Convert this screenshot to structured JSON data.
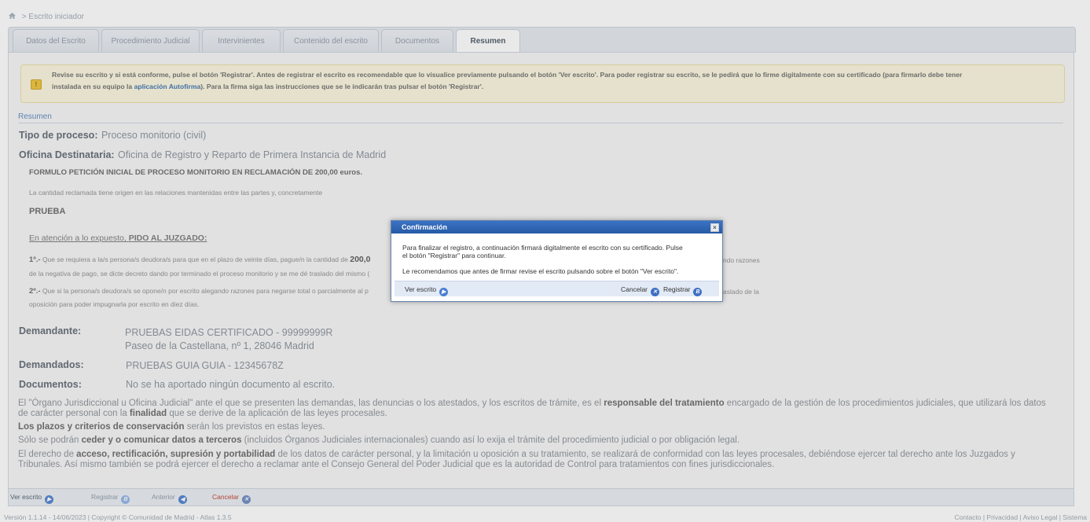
{
  "breadcrumb": {
    "separator": ">",
    "current": "Escrito iniciador"
  },
  "tabs": [
    {
      "label": "Datos del Escrito"
    },
    {
      "label": "Procedimiento Judicial"
    },
    {
      "label": "Intervinientes"
    },
    {
      "label": "Contenido del escrito"
    },
    {
      "label": "Documentos"
    },
    {
      "label": "Resumen"
    }
  ],
  "active_tab": "Resumen",
  "warning": {
    "text1": "Revise su escrito y si está conforme, pulse el botón 'Registrar'. Antes de registrar el escrito es recomendable que lo visualice previamente pulsando el botón 'Ver escrito'. Para poder registrar su escrito, se le pedirá que lo firme digitalmente con su certificado (para firmarlo debe tener",
    "text2": "instalada en su equipo la",
    "link": "aplicación Autofirma",
    "text3": "). Para la firma siga las instrucciones que se le indicarán tras pulsar el botón 'Registrar'."
  },
  "summary": {
    "section_title": "Resumen",
    "tipo_label": "Tipo de proceso:",
    "tipo_value": "Proceso monitorio (civil)",
    "oficina_label": "Oficina Destinataria:",
    "oficina_value": "Oficina de Registro y Reparto de Primera Instancia de Madrid",
    "formulo": "FORMULO PETICIÓN INICIAL DE PROCESO MONITORIO EN RECLAMACIÓN DE 200,00 euros.",
    "origen": "La cantidad reclamada tiene origen en las relaciones mantenidas entre las partes y, concretamente",
    "prueba": "PRUEBA",
    "atencion": "En atención a lo expuesto,",
    "pido": "PIDO AL JUZGADO:",
    "p1_num": "1º.-",
    "p1_a": "Que se requiera a la/s persona/s deudora/s para que en el plazo de veinte días, pague/n la cantidad de",
    "p1_amount": "200,0",
    "p1_right": "ndo razones",
    "p1_b": "de la negativa de pago, se dicte decreto dando por terminado el proceso monitorio y se me dé traslado del mismo (",
    "p2_num": "2º.-",
    "p2_a": "Que si la persona/s deudora/s se opone/n por escrito alegando razones para negarse total o parcialmente al p",
    "p2_right": "aslado de la",
    "p2_b": "oposición para poder impugnarla por escrito en diez días.",
    "demandante_label": "Demandante:",
    "demandante_name": "PRUEBAS EIDAS CERTIFICADO - 99999999R",
    "demandante_addr": "Paseo de la Castellana, nº 1, 28046 Madrid",
    "demandados_label": "Demandados:",
    "demandados_value": "PRUEBAS GUIA GUIA - 12345678Z",
    "documentos_label": "Documentos:",
    "documentos_value": "No se ha aportado ningún documento al escrito."
  },
  "legal": {
    "l1a": "El \"Órgano Jurisdiccional u Oficina Judicial\" ante el que se presenten las demandas, las denuncias o los atestados, y los escritos de trámite, es el",
    "l1b": "responsable del tratamiento",
    "l1c": "encargado de la gestión de los procedimientos judiciales, que utilizará los datos",
    "l2a": "de carácter personal con la",
    "l2b": "finalidad",
    "l2c": "que se derive de la aplicación de las leyes procesales.",
    "l3a": "Los plazos y criterios de conservación",
    "l3b": "serán los previstos en estas leyes.",
    "l4a": "Sólo se podrán",
    "l4b": "ceder y o comunicar datos a terceros",
    "l4c": "(incluidos Órganos Judiciales internacionales) cuando así lo exija el trámite del procedimiento judicial o por obligación legal.",
    "l5a": "El derecho de",
    "l5b": "acceso, rectificación, supresión y portabilidad",
    "l5c": "de los datos de carácter personal, y la limitación u oposición a su tratamiento, se realizará de conformidad con las leyes procesales, debiéndose ejercer tal derecho ante los Juzgados y",
    "l6": "Tribunales. Así mismo también se podrá ejercer el derecho a reclamar ante el Consejo General del Poder Judicial que es la autoridad de Control para tratamientos con fines jurisdiccionales."
  },
  "bottom_bar": {
    "ver": "Ver escrito",
    "registrar": "Registrar",
    "anterior": "Anterior",
    "cancelar": "Cancelar"
  },
  "footer": {
    "left": "Versión 1.1.14 - 14/06/2023 | Copyright © Comunidad de Madrid - Atlas 1.3.5",
    "right": "Contacto | Privacidad | Aviso Legal | Sistema"
  },
  "dialog": {
    "title": "Confirmación",
    "close": "×",
    "line1": "Para finalizar el registro, a continuación firmará digitalmente el escrito con su certificado. Pulse",
    "line2": "el botón \"Registrar\" para continuar.",
    "line3": "Le recomendamos que antes de firmar revise el escrito pulsando sobre el botón \"Ver escrito\".",
    "ver": "Ver escrito",
    "cancelar": "Cancelar",
    "registrar": "Registrar"
  },
  "colors": {
    "accent": "#2f64b3",
    "cancel": "#c0392b",
    "warning_bg": "#fbf6dd"
  }
}
